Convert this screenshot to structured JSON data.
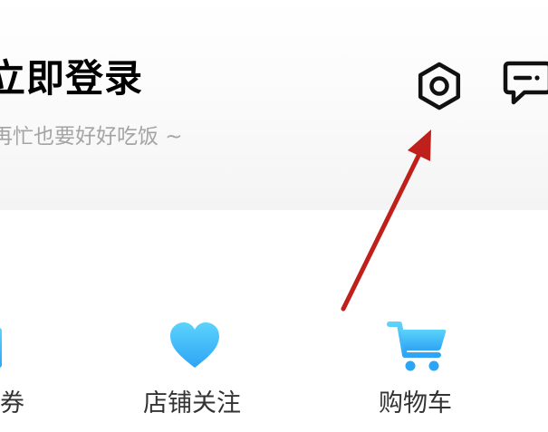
{
  "header": {
    "login_title": "立即登录",
    "login_subtitle": "再忙也要好好吃饭 ~",
    "settings_icon": "gear-icon",
    "message_icon": "message-icon"
  },
  "quick_actions": [
    {
      "label": "券",
      "icon": "coupon-icon"
    },
    {
      "label": "店铺关注",
      "icon": "heart-icon"
    },
    {
      "label": "购物车",
      "icon": "cart-icon"
    }
  ],
  "colors": {
    "icon_gradient_start": "#5bd3fb",
    "icon_gradient_end": "#2ea4f6",
    "arrow": "#c0201b",
    "subtitle": "#a4a4a4"
  }
}
